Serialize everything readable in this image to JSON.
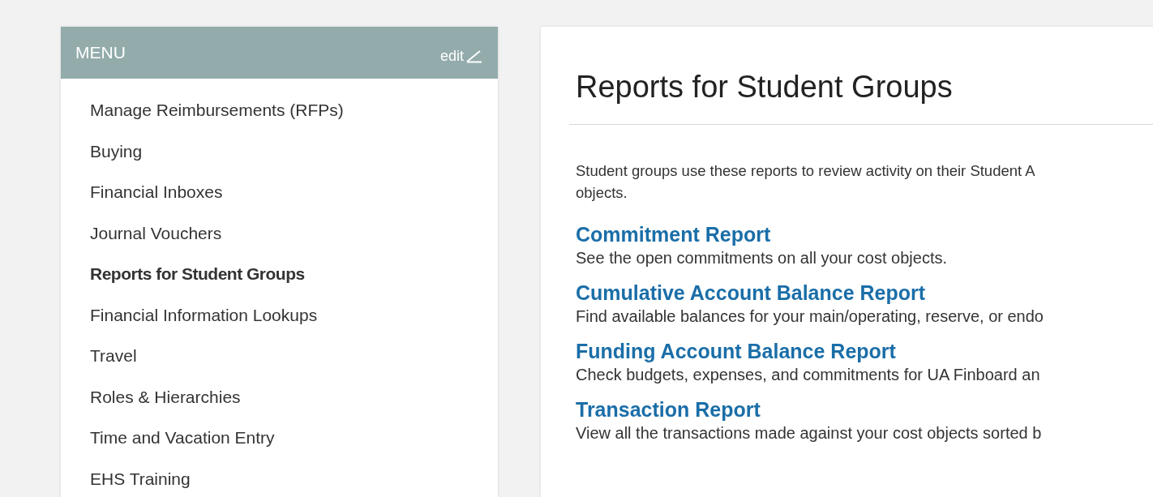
{
  "menu": {
    "title": "MENU",
    "edit_label": "edit",
    "items": [
      {
        "label": "Manage Reimbursements (RFPs)",
        "selected": false
      },
      {
        "label": "Buying",
        "selected": false
      },
      {
        "label": "Financial Inboxes",
        "selected": false
      },
      {
        "label": "Journal Vouchers",
        "selected": false
      },
      {
        "label": "Reports for Student Groups",
        "selected": true
      },
      {
        "label": "Financial Information Lookups",
        "selected": false
      },
      {
        "label": "Travel",
        "selected": false
      },
      {
        "label": "Roles & Hierarchies",
        "selected": false
      },
      {
        "label": "Time and Vacation Entry",
        "selected": false
      },
      {
        "label": "EHS Training",
        "selected": false
      }
    ]
  },
  "content": {
    "title": "Reports for Student Groups",
    "intro": [
      "Student groups use these reports to review activity on their Student A",
      "objects."
    ],
    "reports": [
      {
        "title": "Commitment Report",
        "description": "See the open commitments on all your cost objects."
      },
      {
        "title": "Cumulative Account Balance Report",
        "description": "Find available balances for your main/operating, reserve, or endo"
      },
      {
        "title": "Funding Account Balance Report",
        "description": "Check budgets, expenses, and commitments for UA Finboard an"
      },
      {
        "title": "Transaction Report",
        "description": "View all the transactions made against your cost objects sorted b"
      }
    ]
  }
}
